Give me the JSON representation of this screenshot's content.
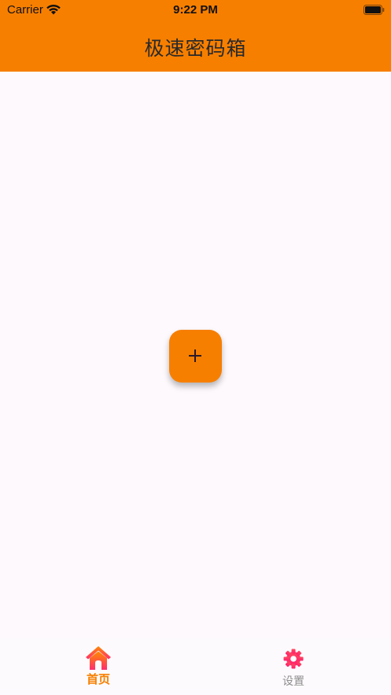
{
  "status_bar": {
    "carrier": "Carrier",
    "time": "9:22 PM"
  },
  "header": {
    "title": "极速密码箱"
  },
  "fab": {
    "icon": "plus-icon",
    "color": "#f77f00"
  },
  "tabbar": {
    "tabs": [
      {
        "label": "首页",
        "icon": "home-icon",
        "active": true,
        "color": "#f77f00"
      },
      {
        "label": "设置",
        "icon": "gear-icon",
        "active": false,
        "color": "#8e8e8e"
      }
    ]
  },
  "colors": {
    "accent": "#f77f00",
    "icon_gradient_top": "#ff8a00",
    "icon_gradient_bottom": "#ff2d6f",
    "background": "#fdf9fd"
  }
}
